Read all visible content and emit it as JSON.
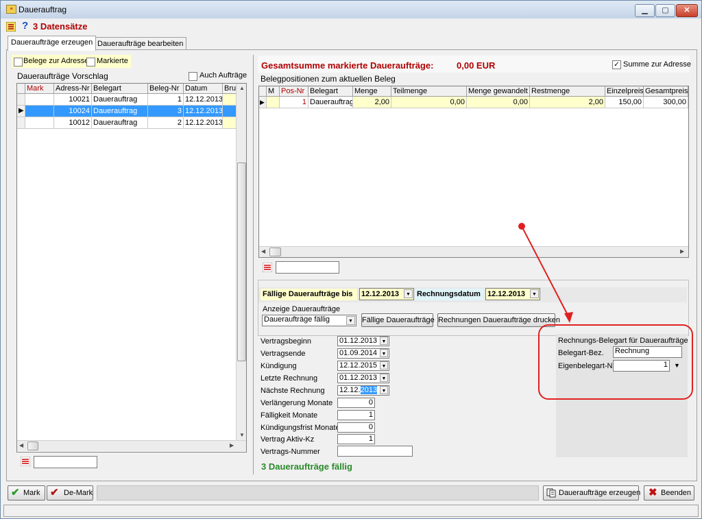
{
  "window": {
    "title": "Dauerauftrag"
  },
  "header": {
    "record_count": "3 Datensätze"
  },
  "tabs": [
    {
      "label": "Daueraufträge erzeugen"
    },
    {
      "label": "Daueraufträge bearbeiten"
    }
  ],
  "left": {
    "chk_belege_adresse": "Belege zur Adresse",
    "chk_markierte": "Markierte",
    "section_title": "Daueraufträge Vorschlag",
    "chk_auch_auftraege": "Auch Aufträge",
    "columns": [
      "Mark",
      "Adress-Nr",
      "Belegart",
      "Beleg-Nr",
      "Datum",
      "Bru"
    ],
    "rows": [
      {
        "mark": "",
        "adress_nr": "10021",
        "belegart": "Dauerauftrag",
        "beleg_nr": "1",
        "datum": "12.12.2013"
      },
      {
        "mark": "",
        "adress_nr": "10024",
        "belegart": "Dauerauftrag",
        "beleg_nr": "3",
        "datum": "12.12.2013"
      },
      {
        "mark": "",
        "adress_nr": "10012",
        "belegart": "Dauerauftrag",
        "beleg_nr": "2",
        "datum": "12.12.2013"
      }
    ]
  },
  "right": {
    "sum_label": "Gesamtsumme markierte Daueraufträge:",
    "sum_value": "0,00 EUR",
    "chk_summe_adresse": "Summe zur Adresse",
    "positions_title": "Belegpositionen zum aktuellen Beleg",
    "columns": [
      "M",
      "Pos-Nr",
      "Belegart",
      "Menge",
      "Teilmenge",
      "Menge gewandelt",
      "Restmenge",
      "Einzelpreis",
      "Gesamtpreis"
    ],
    "rows": [
      {
        "m": "",
        "pos_nr": "1",
        "belegart": "Dauerauftrag",
        "menge": "2,00",
        "teilmenge": "0,00",
        "menge_gewandelt": "0,00",
        "restmenge": "2,00",
        "einzelpreis": "150,00",
        "gesamtpreis": "300,00"
      }
    ]
  },
  "due": {
    "label_bis": "Fällige Daueraufträge bis",
    "date_bis": "12.12.2013",
    "label_rechnungsdatum": "Rechnungsdatum",
    "date_rechnung": "12.12.2013",
    "anzeige_label": "Anzeige Daueraufträge",
    "anzeige_value": "Daueraufträge fällig",
    "btn_faellige": "Fällige Daueraufträge",
    "btn_drucken": "Rechnungen Daueraufträge drucken"
  },
  "contract": {
    "fields": [
      {
        "label": "Vertragsbeginn",
        "value": "01.12.2013"
      },
      {
        "label": "Vertragsende",
        "value": "01.09.2014"
      },
      {
        "label": "Kündigung",
        "value": "12.12.2015"
      },
      {
        "label": "Letzte Rechnung",
        "value": "01.12.2013"
      },
      {
        "label": "Nächste Rechnung",
        "value_prefix": "12.12.",
        "value_selected": "2013"
      }
    ],
    "numbers": [
      {
        "label": "Verlängerung Monate",
        "value": "0"
      },
      {
        "label": "Fälligkeit Monate",
        "value": "1"
      },
      {
        "label": "Kündigungsfrist Monate",
        "value": "0"
      },
      {
        "label": "Vertrag Aktiv-Kz",
        "value": "1"
      },
      {
        "label": "Vertrags-Nummer",
        "value": ""
      }
    ],
    "due_count": "3 Daueraufträge fällig"
  },
  "invoice_type": {
    "title": "Rechnungs-Belegart für Daueraufträge",
    "bez_label": "Belegart-Bez.",
    "bez_value": "Rechnung",
    "nr_label": "Eigenbelegart-Nr.",
    "nr_value": "1"
  },
  "footer": {
    "btn_mark": "Mark",
    "btn_demark": "De-Mark",
    "btn_erzeugen": "Daueraufträge erzeugen",
    "btn_beenden": "Beenden"
  },
  "colors": {
    "accent_red": "#b00000",
    "green": "#2a8a2a",
    "selection": "#3399ff",
    "annotation": "#e02020"
  }
}
